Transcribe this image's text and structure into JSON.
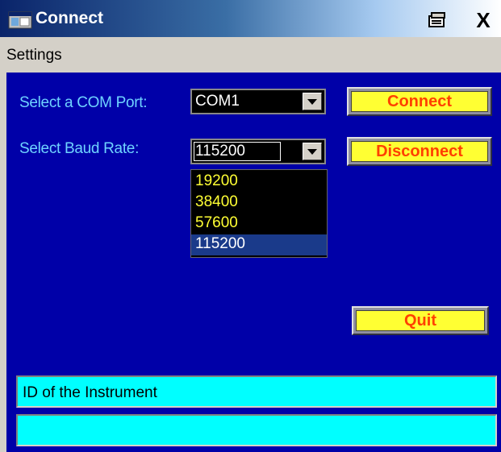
{
  "window": {
    "title": "Connect",
    "icon": "app-window-icon",
    "restore_icon": "restore-icon",
    "close_icon": "close-icon",
    "close_label": "X"
  },
  "menu": {
    "items": [
      {
        "label": "Settings"
      }
    ]
  },
  "form": {
    "com_port_label": "Select a COM Port:",
    "com_port_value": "COM1",
    "baud_label": "Select Baud Rate:",
    "baud_value": "115200",
    "baud_options": [
      {
        "label": "19200"
      },
      {
        "label": "38400"
      },
      {
        "label": "57600"
      },
      {
        "label": "115200"
      }
    ],
    "baud_selected_index": 3
  },
  "buttons": {
    "connect": "Connect",
    "disconnect": "Disconnect",
    "quit": "Quit"
  },
  "fields": {
    "instrument_id": "ID of the Instrument",
    "status": ""
  },
  "colors": {
    "client_background": "#0000a8",
    "label_text": "#6fd3ff",
    "button_face": "#ffff33",
    "button_text": "#ff4000",
    "field_background": "#00ffff",
    "dropdown_text": "#ffff33"
  }
}
